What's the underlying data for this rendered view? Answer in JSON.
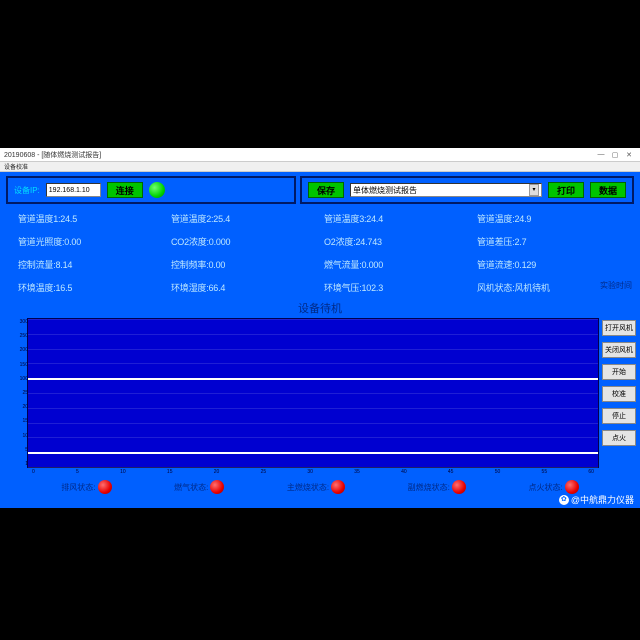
{
  "window": {
    "title": "20190608 - [随体燃烧测试报告]",
    "menu": "设备校准"
  },
  "panel_left": {
    "ip_label": "设备IP:",
    "ip_value": "192.168.1.10",
    "connect": "连接"
  },
  "panel_right": {
    "save": "保存",
    "combo_value": "单体燃烧测试报告",
    "print": "打印",
    "data": "数据"
  },
  "readings": [
    [
      "管道温度1:24.5",
      "管道温度2:25.4",
      "管道温度3:24.4",
      "管道温度:24.9"
    ],
    [
      "管道光照度:0.00",
      "CO2浓度:0.000",
      "O2浓度:24.743",
      "管道差压:2.7"
    ],
    [
      "控制流量:8.14",
      "控制频率:0.00",
      "燃气流量:0.000",
      "管道流速:0.129"
    ],
    [
      "环境温度:16.5",
      "环境湿度:66.4",
      "环境气压:102.3",
      "风机状态:风机待机"
    ]
  ],
  "side_label": "实验时间",
  "center_status": "设备待机",
  "chart_data": {
    "type": "line",
    "y_ticks": [
      "300",
      "250",
      "200",
      "150",
      "100",
      "25",
      "20",
      "15",
      "10",
      "5",
      "1"
    ],
    "x_ticks": [
      "0",
      "5",
      "10",
      "15",
      "20",
      "25",
      "30",
      "35",
      "40",
      "45",
      "50",
      "55",
      "60"
    ],
    "major_line_indices": [
      4,
      9
    ]
  },
  "side_buttons": [
    "打开风机",
    "关闭风机",
    "开始",
    "校准",
    "停止",
    "点火"
  ],
  "status_items": [
    "排风状态:",
    "燃气状态:",
    "主燃烧状态:",
    "副燃烧状态:",
    "点火状态:"
  ],
  "watermark": "@中航鼎力仪器"
}
